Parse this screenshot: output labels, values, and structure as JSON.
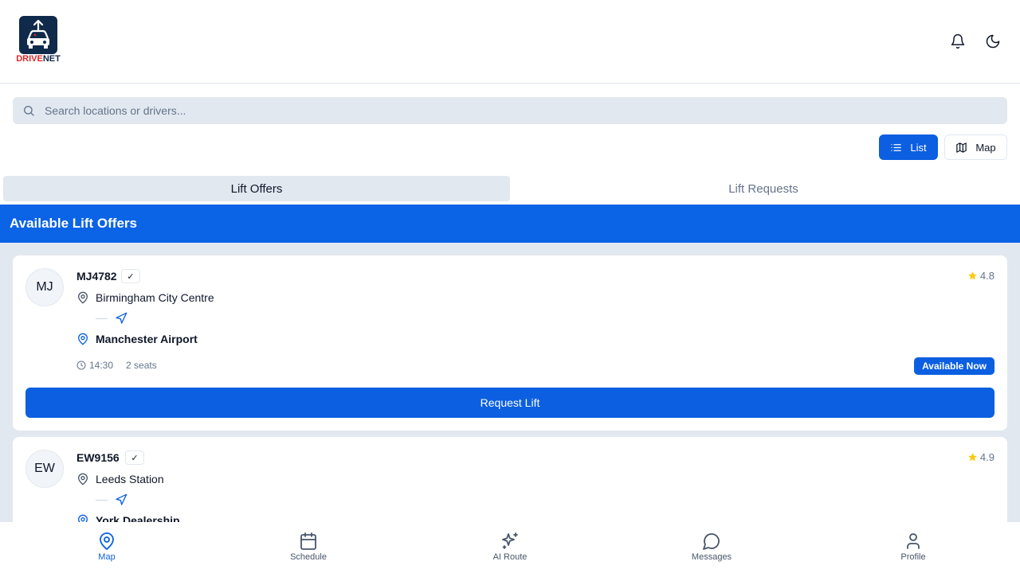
{
  "header": {
    "logo_part1": "DRIVE",
    "logo_part2": "NET",
    "brand_colors": {
      "navy": "#0f2a4a",
      "red": "#dc2626"
    }
  },
  "search": {
    "placeholder": "Search locations or drivers...",
    "value": ""
  },
  "view_toggle": {
    "list_label": "List",
    "map_label": "Map",
    "selected": "List"
  },
  "tabs": [
    {
      "label": "Lift Offers",
      "active": true
    },
    {
      "label": "Lift Requests",
      "active": false
    }
  ],
  "banner": {
    "title": "Available Lift Offers"
  },
  "offers": [
    {
      "initials": "MJ",
      "driver_id": "MJ4782",
      "verified": "✓",
      "rating": "4.8",
      "from": "Birmingham City Centre",
      "to": "Manchester Airport",
      "time": "14:30",
      "seats": "2 seats",
      "status": "Available Now",
      "action": "Request Lift"
    },
    {
      "initials": "EW",
      "driver_id": "EW9156",
      "verified": "✓",
      "rating": "4.9",
      "from": "Leeds Station",
      "to": "York Dealership"
    }
  ],
  "bottom_nav": [
    {
      "label": "Map",
      "icon": "map-pin-icon",
      "active": true
    },
    {
      "label": "Schedule",
      "icon": "calendar-icon",
      "active": false
    },
    {
      "label": "AI Route",
      "icon": "sparkles-icon",
      "active": false
    },
    {
      "label": "Messages",
      "icon": "message-icon",
      "active": false
    },
    {
      "label": "Profile",
      "icon": "user-icon",
      "active": false
    }
  ],
  "colors": {
    "accent": "#0b5fe0",
    "banner": "#0b63e6",
    "list_background": "#e2e8f0",
    "star": "#facc15"
  }
}
